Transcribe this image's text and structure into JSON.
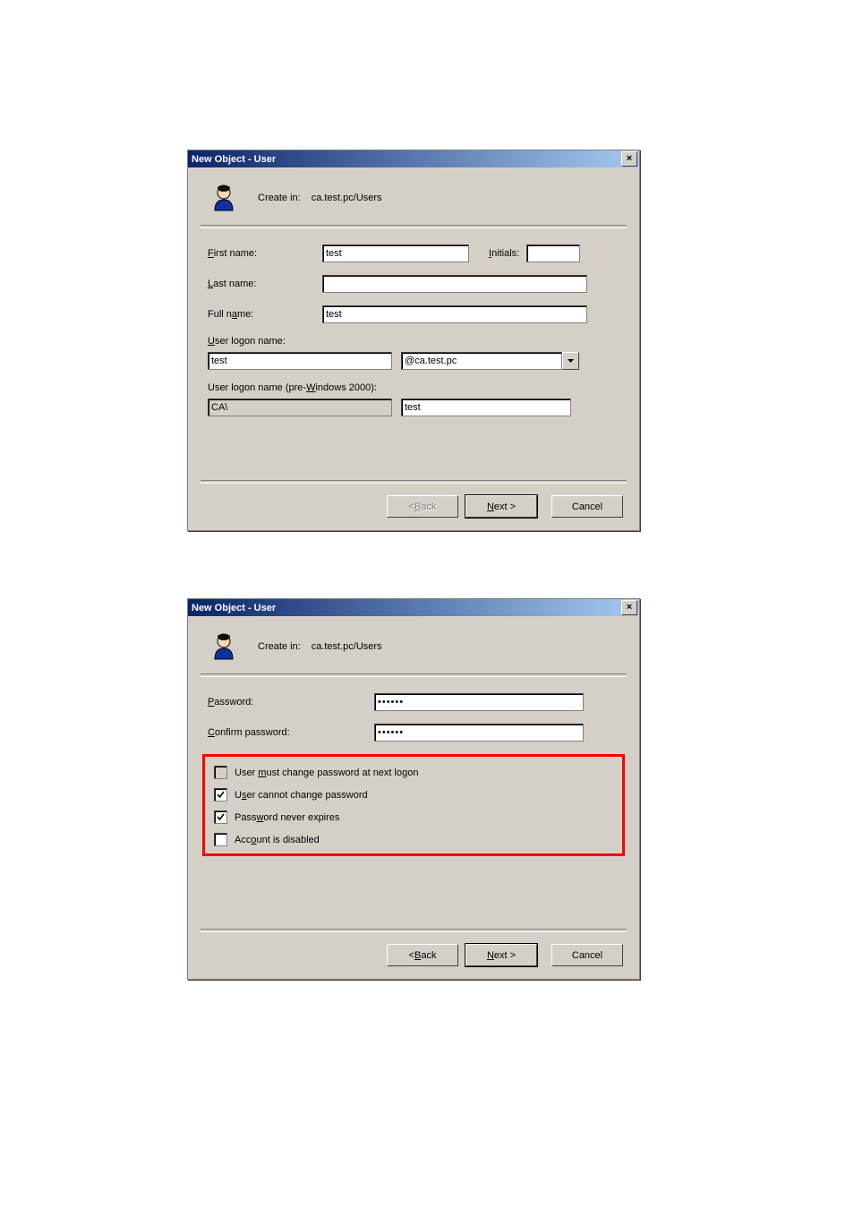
{
  "dialog1": {
    "title": "New Object - User",
    "create_in_label": "Create in:",
    "create_in_path": "ca.test.pc/Users",
    "first_name_label": "First name:",
    "first_name_underline": "F",
    "first_name_value": "test",
    "initials_label": "Initials:",
    "initials_underline": "I",
    "initials_value": "",
    "last_name_label": "Last name:",
    "last_name_underline": "L",
    "last_name_value": "",
    "full_name_label": "Full name:",
    "full_name_underline": "a",
    "full_name_value": "test",
    "logon_label": "User logon name:",
    "logon_underline": "U",
    "logon_value": "test",
    "logon_domain": "@ca.test.pc",
    "pre2000_label": "User logon name (pre-Windows 2000):",
    "pre2000_underline": "W",
    "pre2000_domain": "CA\\",
    "pre2000_value": "test",
    "back_label": "< Back",
    "back_underline": "B",
    "next_label": "Next >",
    "next_underline": "N",
    "cancel_label": "Cancel"
  },
  "dialog2": {
    "title": "New Object - User",
    "create_in_label": "Create in:",
    "create_in_path": "ca.test.pc/Users",
    "password_label": "Password:",
    "password_underline": "P",
    "password_value": "••••••",
    "confirm_label": "Confirm password:",
    "confirm_underline": "C",
    "confirm_value": "••••••",
    "opt_mustchange": "User must change password at next logon",
    "opt_mustchange_underline": "m",
    "opt_mustchange_checked": false,
    "opt_cannotchange": "User cannot change password",
    "opt_cannotchange_underline": "s",
    "opt_cannotchange_checked": true,
    "opt_neverexpires": "Password never expires",
    "opt_neverexpires_underline": "w",
    "opt_neverexpires_checked": true,
    "opt_disabled": "Account is disabled",
    "opt_disabled_underline": "o",
    "opt_disabled_checked": false,
    "back_label": "< Back",
    "back_underline": "B",
    "next_label": "Next >",
    "next_underline": "N",
    "cancel_label": "Cancel"
  }
}
